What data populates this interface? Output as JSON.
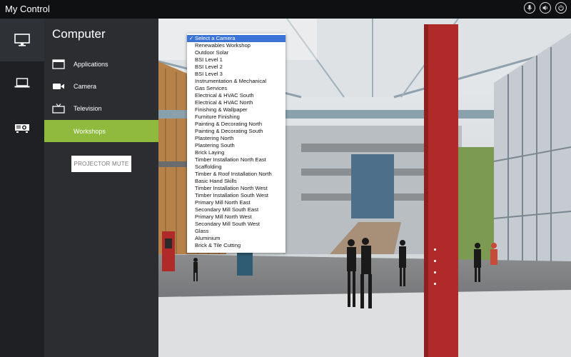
{
  "app": {
    "title": "My Control"
  },
  "top_icons": [
    "microphone-icon",
    "speaker-icon",
    "power-icon"
  ],
  "devices": [
    {
      "name": "computer-icon",
      "active": true
    },
    {
      "name": "laptop-icon",
      "active": false
    },
    {
      "name": "projector-icon",
      "active": false
    }
  ],
  "panel": {
    "title": "Computer",
    "items": [
      {
        "label": "Applications",
        "icon": "window-icon"
      },
      {
        "label": "Camera",
        "icon": "video-camera-icon"
      },
      {
        "label": "Television",
        "icon": "television-icon"
      },
      {
        "label": "Workshops",
        "icon": "",
        "selected": true
      }
    ],
    "projector_mute_label": "PROJECTOR MUTE"
  },
  "camera_select": {
    "selected_index": 0,
    "options": [
      "Select a Camera",
      "Renewables Workshop",
      "Outdoor Solar",
      "BSI Level 1",
      "BSI Level 2",
      "BSI Level 3",
      "Instrumentation & Mechanical",
      "Gas Services",
      "Electrical & HVAC South",
      "Electrical & HVAC North",
      "Finishing & Wallpaper",
      "Furniture Finishing",
      "Painting & Decorating North",
      "Painting & Decorating South",
      "Plastering North",
      "Plastering South",
      "Brick Laying",
      "Timber Installation North East",
      "Scaffolding",
      "Timber & Roof Installation North",
      "Basic Hand Skills",
      "Timber Installation North West",
      "Timber Installation South West",
      "Primary Mill North East",
      "Secondary Mill South East",
      "Primary Mill North West",
      "Secondary Mill South West",
      "Glass",
      "Aluminium",
      "Brick & Tile Cutting"
    ]
  },
  "colors": {
    "accent": "#8fba3e",
    "select_highlight": "#3b73d6",
    "pillar_red": "#b02a2a"
  }
}
